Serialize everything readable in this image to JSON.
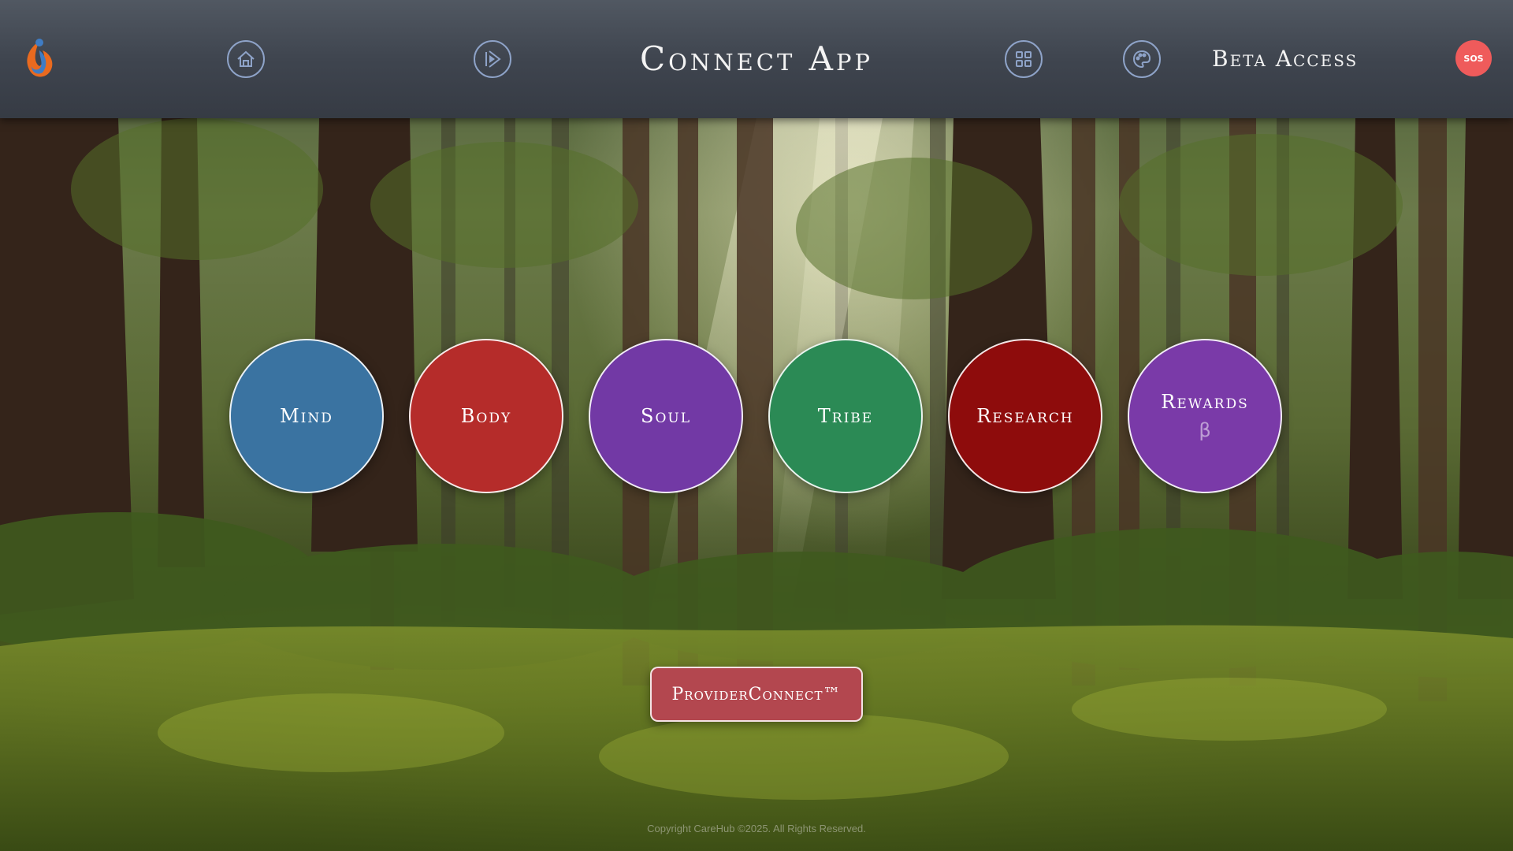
{
  "header": {
    "title": "Connect App",
    "beta_label": "Beta Access",
    "sos_label": "SOS",
    "icons": [
      "app-logo-icon",
      "home-icon",
      "forward-icon",
      "grid-icon",
      "palette-icon"
    ]
  },
  "circles": [
    {
      "label": "Mind",
      "color": "#3a73a1"
    },
    {
      "label": "Body",
      "color": "#b52c2a"
    },
    {
      "label": "Soul",
      "color": "#7239a5"
    },
    {
      "label": "Tribe",
      "color": "#2b8a55"
    },
    {
      "label": "Research",
      "color": "#8e0c0c"
    },
    {
      "label": "Rewards",
      "sub": "β",
      "color": "#7a3aa8"
    }
  ],
  "provider_button": {
    "label": "ProviderConnect™",
    "color": "#b3474f"
  },
  "footer": {
    "copyright": "Copyright CareHub ©2025. All Rights Reserved."
  },
  "theme": {
    "sos_color": "#ef5b5b",
    "topbar_color": "#444a53",
    "icon_ring_color": "#8ea3c8"
  }
}
